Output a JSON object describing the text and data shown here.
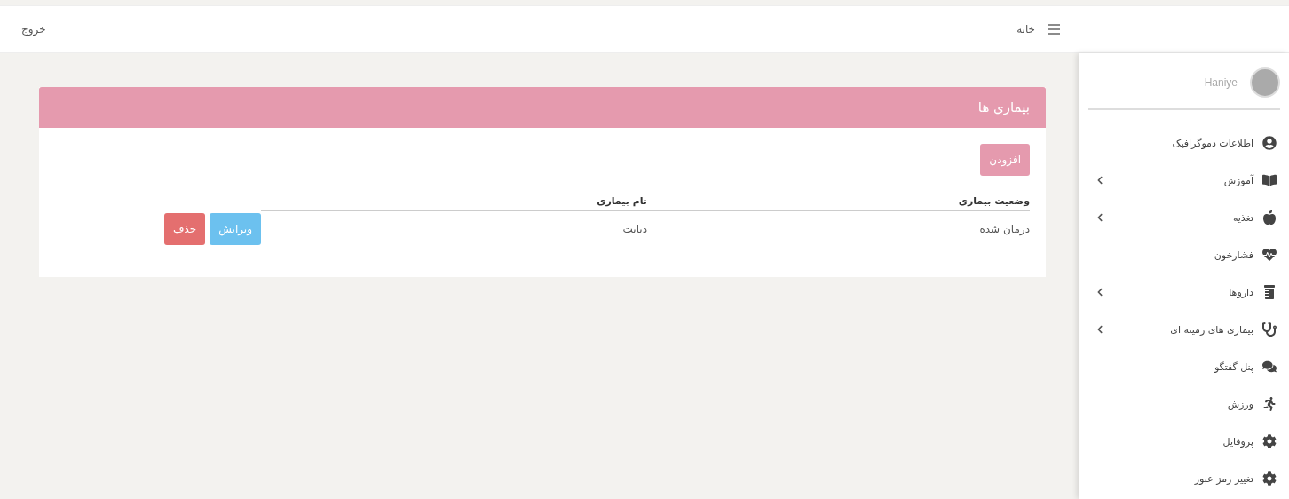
{
  "topbar": {
    "menu_label": "خانه",
    "logout": "خروج"
  },
  "sidebar": {
    "user": {
      "name": "Haniye"
    },
    "items": [
      {
        "label": "اطلاعات دموگرافیک",
        "has_submenu": false
      },
      {
        "label": "آموزش",
        "has_submenu": true
      },
      {
        "label": "تغذیه",
        "has_submenu": true
      },
      {
        "label": "فشارخون",
        "has_submenu": false
      },
      {
        "label": "داروها",
        "has_submenu": true
      },
      {
        "label": "بیماری های زمینه ای",
        "has_submenu": true
      },
      {
        "label": "پنل گفتگو",
        "has_submenu": false
      },
      {
        "label": "ورزش",
        "has_submenu": false
      },
      {
        "label": "پروفایل",
        "has_submenu": false
      },
      {
        "label": "تغییر رمز عبور",
        "has_submenu": false
      }
    ]
  },
  "panel": {
    "title": "بیماری ها",
    "add_button": "افزودن",
    "table": {
      "columns": [
        "وضعیت بیماری",
        "نام بیماری"
      ],
      "rows": [
        {
          "status": "درمان شده",
          "name": "دیابت",
          "actions": [
            {
              "kind": "edit",
              "label": "ویرایش"
            },
            {
              "kind": "delete",
              "label": "حذف"
            }
          ]
        }
      ]
    }
  }
}
